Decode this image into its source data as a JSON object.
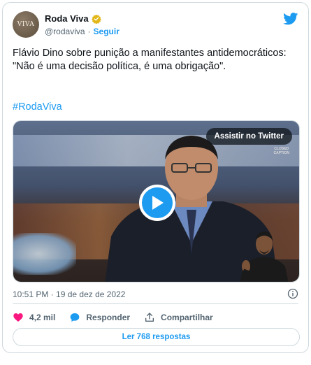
{
  "account": {
    "display_name": "Roda Viva",
    "handle": "@rodaviva",
    "separator": "·",
    "follow_label": "Seguir",
    "avatar_text": "VIVA"
  },
  "tweet": {
    "text": "Flávio Dino sobre punição a manifestantes antidemocráticos: \"Não é uma decisão política, é uma obrigação\".",
    "hashtag": "#RodaViva",
    "timestamp": "10:51 PM · 19 de dez de 2022"
  },
  "media": {
    "watch_label": "Assistir no Twitter",
    "cc_line1": "CLOSED",
    "cc_line2": "CAPTION"
  },
  "actions": {
    "likes": "4,2 mil",
    "reply_label": "Responder",
    "share_label": "Compartilhar"
  },
  "replies_button": "Ler 768 respostas",
  "colors": {
    "accent": "#1d9bf0",
    "like": "#f91880",
    "verified": "#e2b719"
  },
  "icons": [
    "verified-badge-icon",
    "twitter-bird-icon",
    "play-icon",
    "info-icon",
    "heart-icon",
    "reply-bubble-icon",
    "share-icon"
  ]
}
